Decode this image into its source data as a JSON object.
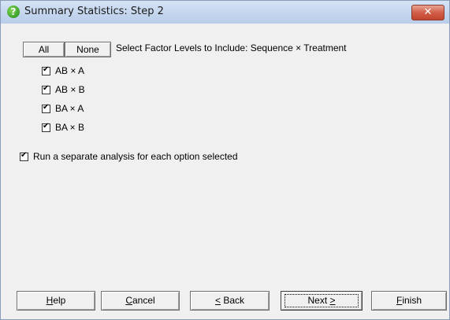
{
  "window": {
    "title": "Summary Statistics: Step 2",
    "close_label": "✕"
  },
  "selector": {
    "all_label": "All",
    "none_label": "None",
    "instruction": "Select Factor Levels to Include: Sequence × Treatment",
    "items": [
      {
        "label": "AB × A",
        "checked": true
      },
      {
        "label": "AB × B",
        "checked": true
      },
      {
        "label": "BA × A",
        "checked": true
      },
      {
        "label": "BA × B",
        "checked": true
      }
    ]
  },
  "option": {
    "label": "Run a separate analysis for each option selected",
    "checked": true
  },
  "footer": {
    "help": {
      "pre": "",
      "key": "H",
      "post": "elp"
    },
    "cancel": {
      "pre": "",
      "key": "C",
      "post": "ancel"
    },
    "back": {
      "pre": "",
      "key": "<",
      "post": " Back"
    },
    "next": {
      "pre": "Next ",
      "key": ">",
      "post": ""
    },
    "finish": {
      "pre": "",
      "key": "F",
      "post": "inish"
    }
  }
}
